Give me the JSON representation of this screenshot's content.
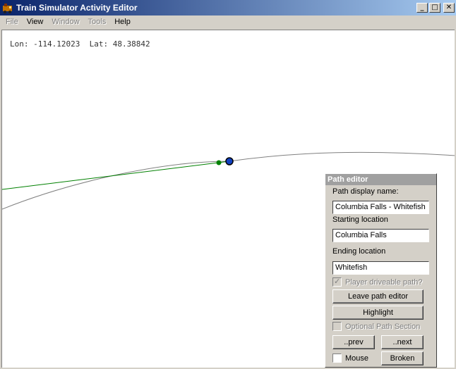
{
  "window": {
    "title": "Train Simulator Activity Editor",
    "minimize_glyph": "_",
    "maximize_glyph": "□",
    "close_glyph": "✕"
  },
  "menu": [
    {
      "label": "File",
      "enabled": false
    },
    {
      "label": "View",
      "enabled": true
    },
    {
      "label": "Window",
      "enabled": false
    },
    {
      "label": "Tools",
      "enabled": false
    },
    {
      "label": "Help",
      "enabled": true
    }
  ],
  "map": {
    "coords_text": "Lon: -114.12023  Lat: 48.38842",
    "track_color": "#808080",
    "path_color": "#008000",
    "marker_color": "#1040c0"
  },
  "path_editor": {
    "title": "Path editor",
    "display_name_label": "Path display name:",
    "display_name_value": "Columbia Falls - Whitefish",
    "start_label": "Starting location",
    "start_value": "Columbia Falls",
    "end_label": "Ending location",
    "end_value": "Whitefish",
    "player_driveable_label": "Player driveable path?",
    "player_driveable_checked": true,
    "leave_button": "Leave path editor",
    "highlight_button": "Highlight",
    "optional_section_label": "Optional Path Section",
    "prev_button": "..prev",
    "next_button": "..next",
    "mouse_label": "Mouse",
    "broken_button": "Broken"
  }
}
